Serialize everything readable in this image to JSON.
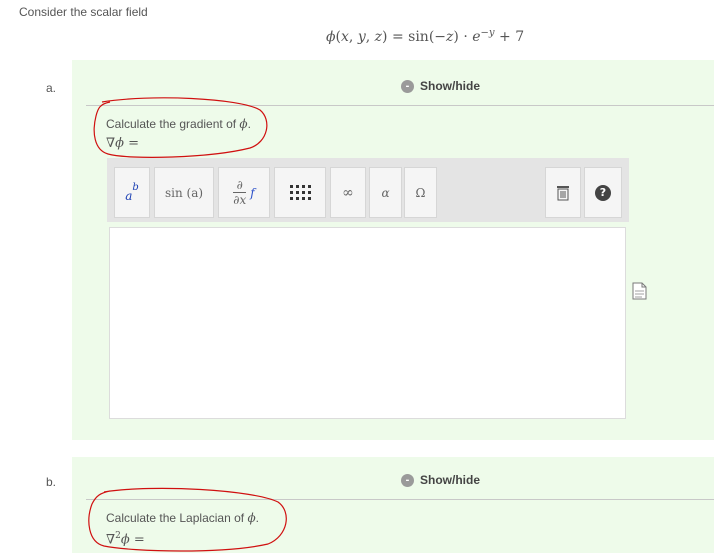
{
  "intro": "Consider the scalar field",
  "field_formula": "ϕ(x, y, z) = sin(−z) · e−y + 7",
  "parts": [
    {
      "letter": "a.",
      "toggle_label": "Show/hide",
      "prompt_text": "Calculate the gradient of ",
      "symbol": "ϕ",
      "prompt_end": ".",
      "lhs": "∇ϕ ="
    },
    {
      "letter": "b.",
      "toggle_label": "Show/hide",
      "prompt_text": "Calculate the Laplacian of ",
      "symbol": "ϕ",
      "prompt_end": ".",
      "lhs": "∇2ϕ ="
    }
  ],
  "toolbar": {
    "superscript_base": "a",
    "superscript_exp": "b",
    "function_label": "sin (a)",
    "derivative_num": "∂",
    "derivative_den": "∂x",
    "derivative_f": "f",
    "infinity": "∞",
    "alpha": "α",
    "omega": "Ω",
    "help": "?"
  },
  "colors": {
    "panel_bg": "#eefbea",
    "annotation_red": "#d01010",
    "toolbar_bg": "#e4e4e4",
    "superscript_blue": "#1b3fb3",
    "derivative_f_blue": "#2a4fc9"
  },
  "icons": {
    "show_hide": "minus-circle-icon",
    "matrix": "matrix-grid-icon",
    "clear": "trash-icon",
    "help": "help-icon",
    "document": "document-icon"
  }
}
